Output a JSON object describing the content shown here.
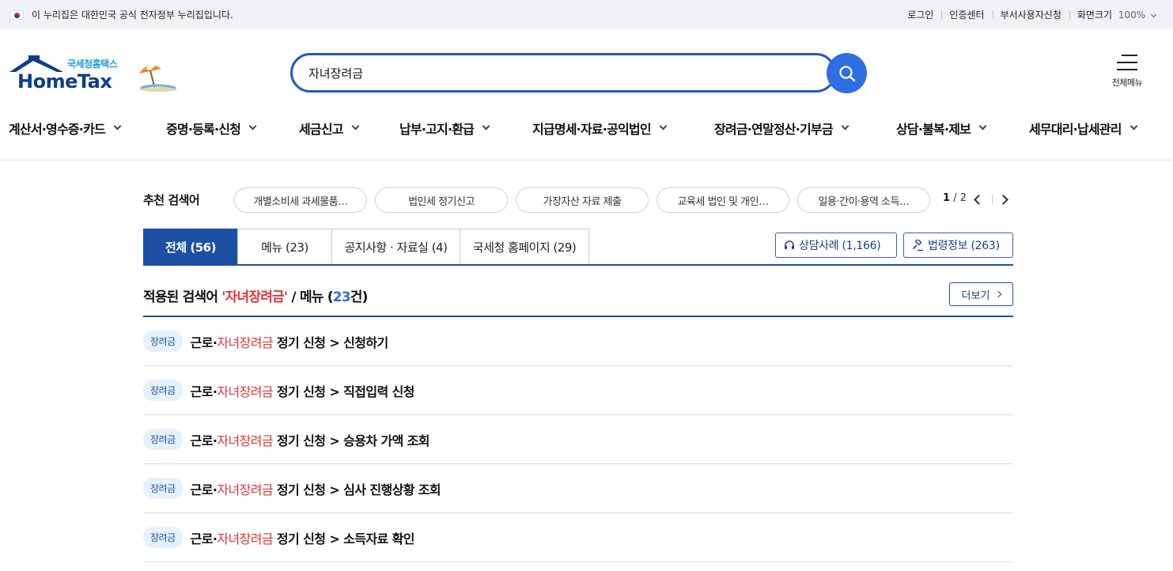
{
  "gov_banner": {
    "text": "이 누리집은 대한민국 공식 전자정부 누리집입니다.",
    "links": [
      "로그인",
      "인증센터",
      "부서사용자신청"
    ],
    "zoom_label": "화면크기",
    "zoom_value": "100%"
  },
  "logo": {
    "sub": "국세청홈택스",
    "main": "HomeTax"
  },
  "search": {
    "value": "자녀장려금"
  },
  "all_menu": {
    "label": "전체메뉴"
  },
  "gnb": [
    "계산서·영수증·카드",
    "증명·등록·신청",
    "세금신고",
    "납부·고지·환급",
    "지급명세·자료·공익법인",
    "장려금·연말정산·기부금",
    "상담·불복·제보",
    "세무대리·납세관리"
  ],
  "recommended": {
    "title": "추천 검색어",
    "chips": [
      "개별소비세 과세물품…",
      "법인세 정기신고",
      "가장자산 자료 제출",
      "교육세 법인 및 개인…",
      "일용·간이·용역 소득…"
    ],
    "page_current": "1",
    "page_sep": "/",
    "page_total": "2"
  },
  "tabs": [
    "전체 (56)",
    "메뉴 (23)",
    "공지사항 · 자료실 (4)",
    "국세청 홈페이지 (29)"
  ],
  "tools": {
    "consult": "상담사례 (1,166)",
    "law": "법령정보 (263)"
  },
  "result_head": {
    "prefix": "적용된 검색어 ",
    "keyword": "'자녀장려금'",
    "mid": " / 메뉴 (",
    "count": "23",
    "suffix": "건)",
    "more": "더보기"
  },
  "results": [
    {
      "badge": "장려금",
      "pre": "근로·",
      "hl": "자녀장려금",
      "post": " 정기 신청 > 신청하기"
    },
    {
      "badge": "장려금",
      "pre": "근로·",
      "hl": "자녀장려금",
      "post": " 정기 신청 > 직접입력 신청"
    },
    {
      "badge": "장려금",
      "pre": "근로·",
      "hl": "자녀장려금",
      "post": " 정기 신청 > 승용차 가액 조회"
    },
    {
      "badge": "장려금",
      "pre": "근로·",
      "hl": "자녀장려금",
      "post": " 정기 신청 > 심사 진행상황 조회"
    },
    {
      "badge": "장려금",
      "pre": "근로·",
      "hl": "자녀장려금",
      "post": " 정기 신청 > 소득자료 확인"
    }
  ],
  "colors": {
    "primary": "#1d4fa5",
    "accent": "#2e6ee4",
    "highlight": "#e0353b"
  }
}
